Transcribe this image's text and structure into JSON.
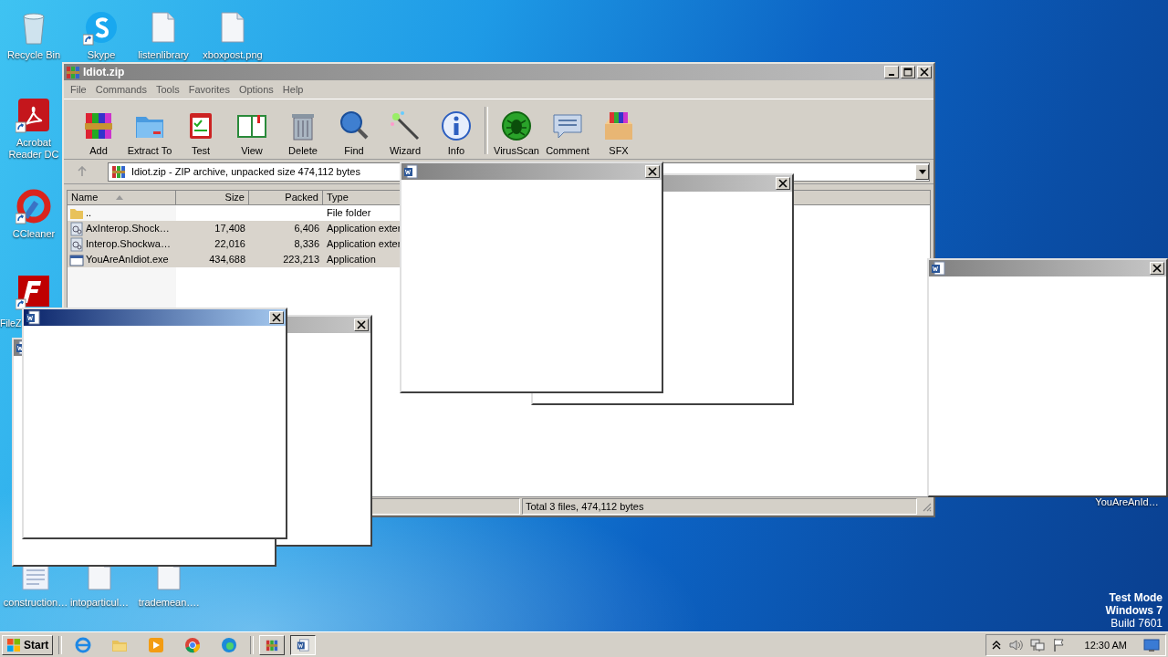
{
  "desktop_icons": [
    {
      "label": "Recycle Bin",
      "kind": "recycle"
    },
    {
      "label": "Skype",
      "kind": "skype",
      "shortcut": true
    },
    {
      "label": "listenlibrary",
      "kind": "blank"
    },
    {
      "label": "xboxpost.png",
      "kind": "blank"
    },
    {
      "label": "Acrobat Reader DC",
      "kind": "acrobat",
      "shortcut": true
    },
    {
      "label": "CCleaner",
      "kind": "ccleaner",
      "shortcut": true
    },
    {
      "label": "FileZ",
      "kind": "filezilla",
      "shortcut": true
    },
    {
      "label": "construction…",
      "kind": "document"
    },
    {
      "label": "intoparticul…",
      "kind": "blank"
    },
    {
      "label": "trademean….",
      "kind": "blank"
    },
    {
      "label": "YouAreAnId…",
      "kind": "none"
    }
  ],
  "archiver": {
    "title": "Idiot.zip",
    "active": false,
    "menu": [
      "File",
      "Commands",
      "Tools",
      "Favorites",
      "Options",
      "Help"
    ],
    "toolbar": [
      {
        "label": "Add",
        "kind": "add"
      },
      {
        "label": "Extract To",
        "kind": "extract"
      },
      {
        "label": "Test",
        "kind": "test"
      },
      {
        "label": "View",
        "kind": "view"
      },
      {
        "label": "Delete",
        "kind": "delete"
      },
      {
        "label": "Find",
        "kind": "find"
      },
      {
        "label": "Wizard",
        "kind": "wizard"
      },
      {
        "label": "Info",
        "kind": "info"
      },
      {
        "label": "VirusScan",
        "kind": "virus",
        "separator_before": true
      },
      {
        "label": "Comment",
        "kind": "comment"
      },
      {
        "label": "SFX",
        "kind": "sfx"
      }
    ],
    "address": "Idiot.zip - ZIP archive, unpacked size 474,112 bytes",
    "columns": [
      "Name",
      "Size",
      "Packed",
      "Type"
    ],
    "rows": [
      {
        "name": "..",
        "size": "",
        "packed": "",
        "type": "File folder",
        "kind": "folder",
        "selected": false
      },
      {
        "name": "AxInterop.Shock…",
        "size": "17,408",
        "packed": "6,406",
        "type": "Application exter",
        "kind": "dll",
        "selected": true
      },
      {
        "name": "Interop.Shockwa…",
        "size": "22,016",
        "packed": "8,336",
        "type": "Application exter",
        "kind": "dll",
        "selected": true
      },
      {
        "name": "YouAreAnIdiot.exe",
        "size": "434,688",
        "packed": "223,213",
        "type": "Application",
        "kind": "exe",
        "selected": true
      }
    ],
    "status": "Total 3 files, 474,112 bytes"
  },
  "popups": [
    {
      "active": false
    },
    {
      "active": false
    },
    {
      "active": false
    },
    {
      "active": false
    },
    {
      "active": false
    },
    {
      "active": true
    }
  ],
  "watermark_text": [
    "Test Mode",
    "Windows 7",
    "Build 7601"
  ],
  "taskbar": {
    "start": "Start",
    "apps": [
      {
        "kind": "ie"
      },
      {
        "kind": "explorer"
      },
      {
        "kind": "media"
      },
      {
        "kind": "chrome"
      },
      {
        "kind": "edge"
      }
    ],
    "tasks": [
      {
        "kind": "archive",
        "selected": false
      },
      {
        "kind": "word",
        "selected": true
      }
    ],
    "clock": "12:30 AM"
  }
}
